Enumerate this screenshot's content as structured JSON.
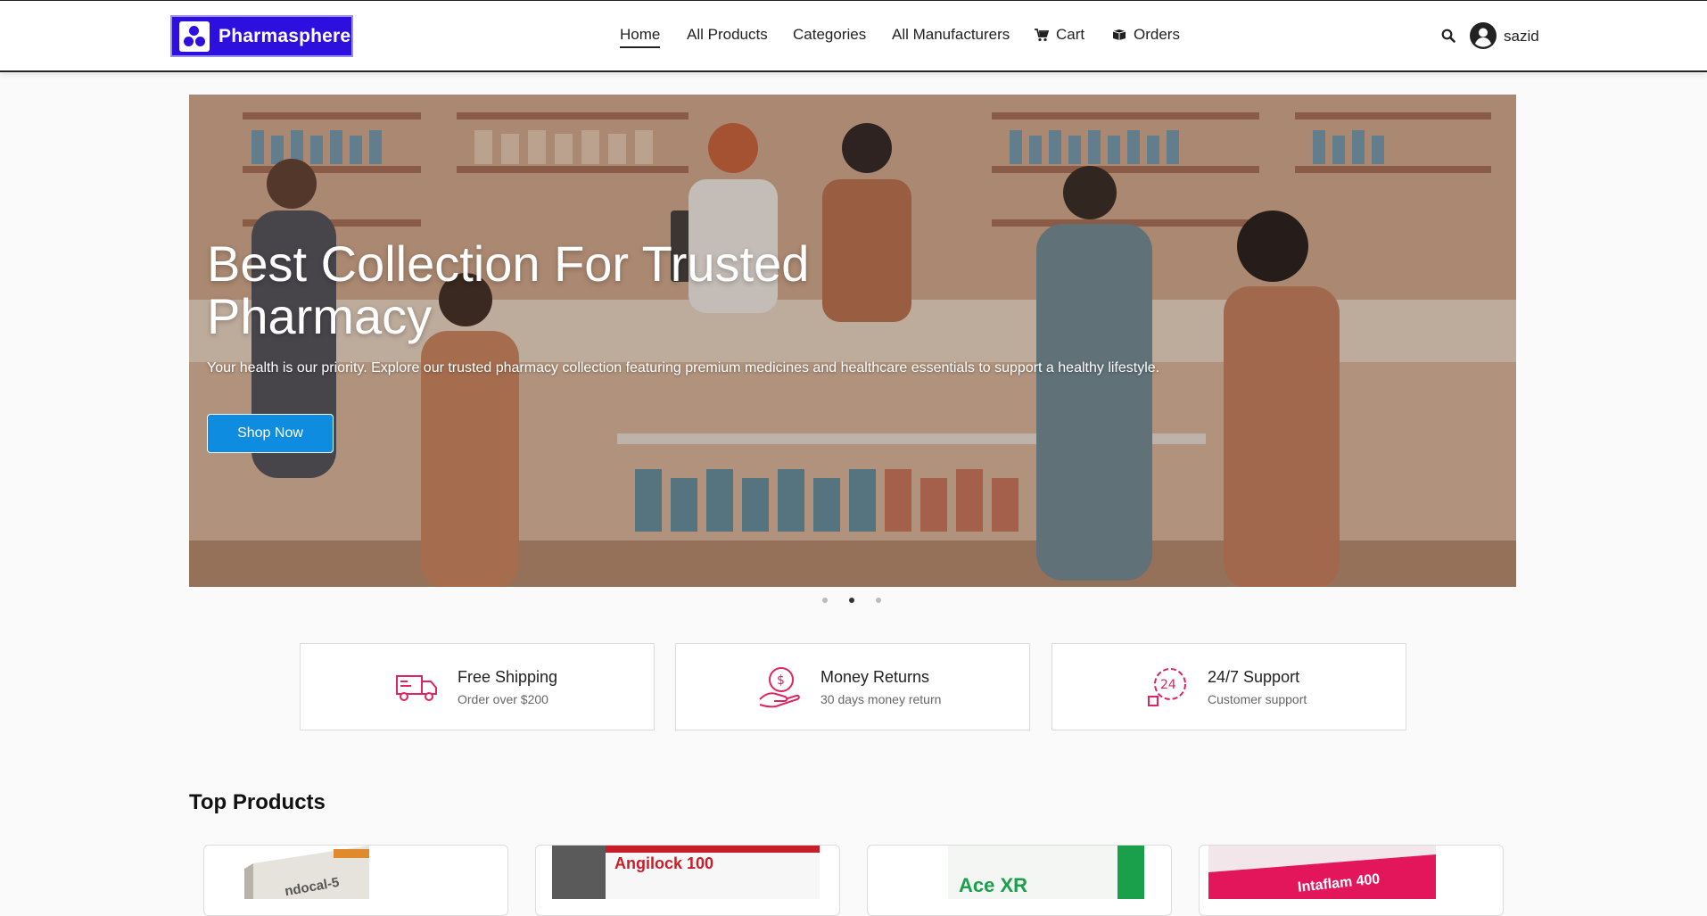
{
  "brand": {
    "name": "Pharmasphere"
  },
  "nav": {
    "items": [
      {
        "label": "Home",
        "active": true
      },
      {
        "label": "All Products"
      },
      {
        "label": "Categories"
      },
      {
        "label": "All Manufacturers"
      },
      {
        "label": "Cart",
        "icon": "cart-icon"
      },
      {
        "label": "Orders",
        "icon": "box-icon"
      }
    ]
  },
  "user": {
    "name": "sazid"
  },
  "hero": {
    "title": "Best Collection For Trusted Pharmacy",
    "subtitle": "Your health is our priority. Explore our trusted pharmacy collection featuring premium medicines and healthcare essentials to support a healthy lifestyle.",
    "cta": "Shop Now",
    "slide_count": 3,
    "active_slide": 2
  },
  "features": [
    {
      "title": "Free Shipping",
      "subtitle": "Order over $200",
      "icon": "truck-icon"
    },
    {
      "title": "Money Returns",
      "subtitle": "30 days money return",
      "icon": "money-hand-icon"
    },
    {
      "title": "24/7 Support",
      "subtitle": "Customer support",
      "icon": "support-24-icon"
    }
  ],
  "top_products": {
    "title": "Top Products",
    "items": [
      {
        "label": "ndocal-5"
      },
      {
        "label": "Angilock 100"
      },
      {
        "label": "Ace XR"
      },
      {
        "label": "Intaflam 400"
      }
    ]
  },
  "colors": {
    "brand": "#2d0fe0",
    "accent": "#0e8de0",
    "icon": "#e0245e"
  }
}
